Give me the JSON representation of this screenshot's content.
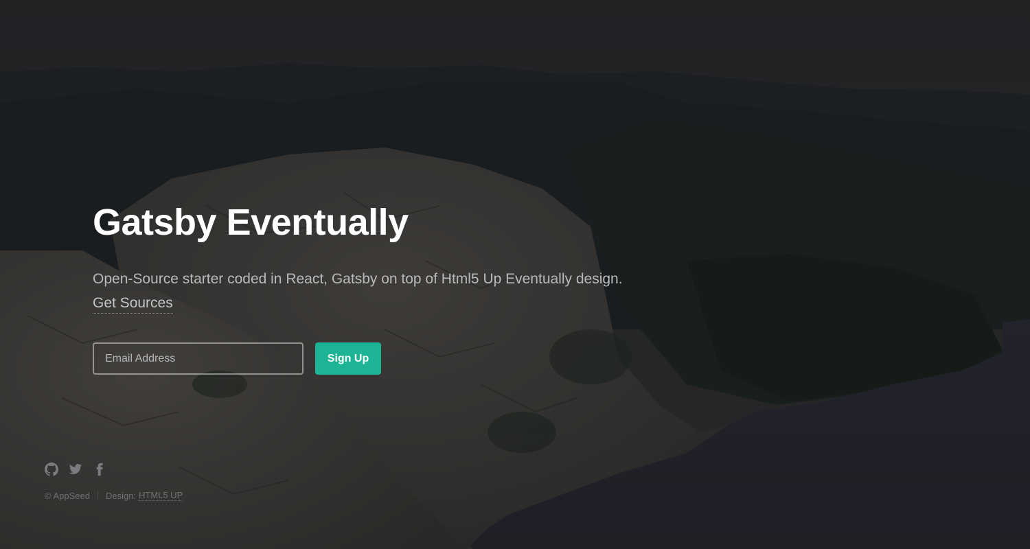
{
  "hero": {
    "title": "Gatsby Eventually",
    "subtitle": "Open-Source starter coded in React, Gatsby on top of Html5 Up Eventually design.",
    "link_label": "Get Sources"
  },
  "signup_form": {
    "email_placeholder": "Email Address",
    "email_value": "",
    "button_label": "Sign Up"
  },
  "footer": {
    "social_icons": [
      "github-icon",
      "twitter-icon",
      "facebook-icon"
    ],
    "copyright": "© AppSeed",
    "design_prefix": "Design:",
    "design_link": "HTML5 UP"
  },
  "colors": {
    "accent": "#1cb495",
    "title_text": "#ffffff",
    "muted_text": "#b8b9bb"
  }
}
